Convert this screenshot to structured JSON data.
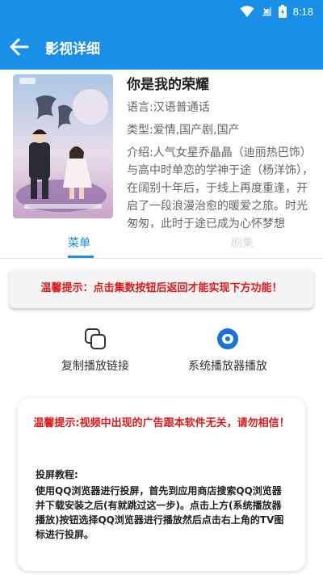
{
  "status_bar": {
    "time": "8:18"
  },
  "app_bar": {
    "title": "影视详细"
  },
  "movie": {
    "name": "你是我的荣耀",
    "language": "语言:汉语普通话",
    "genre": "类型:爱情,国产剧,国产",
    "intro": "介绍:人气女星乔晶晶（迪丽热巴饰）与高中时单恋的学神于途（杨洋饰），在阔别十年后，于线上再度重逢，开启了一段浪漫治愈的暖爱之旅。时光匆匆，此时于途已成为心怀梦想"
  },
  "tabs": [
    {
      "label": "菜单"
    },
    {
      "label": "剧集"
    }
  ],
  "notice_top": "温馨提示：点击集数按钮后返回才能实现下方功能！",
  "actions": {
    "copy_link": "复制播放链接",
    "system_player": "系统播放器播放"
  },
  "notice_box": {
    "warning": "温馨提示:视频中出现的广告跟本软件无关，请勿相信！",
    "tutorial_title": "投屏教程:",
    "tutorial_body": "使用QQ浏览器进行投屏，首先到应用商店搜索QQ浏览器并下载安装之后(有就跳过这一步)。点击上方(系统播放器播放)按钮选择QQ浏览器进行播放然后点击右上角的TV图标进行投屏。"
  },
  "colors": {
    "accent": "#1a8fe8",
    "warning_red": "#e01818"
  }
}
